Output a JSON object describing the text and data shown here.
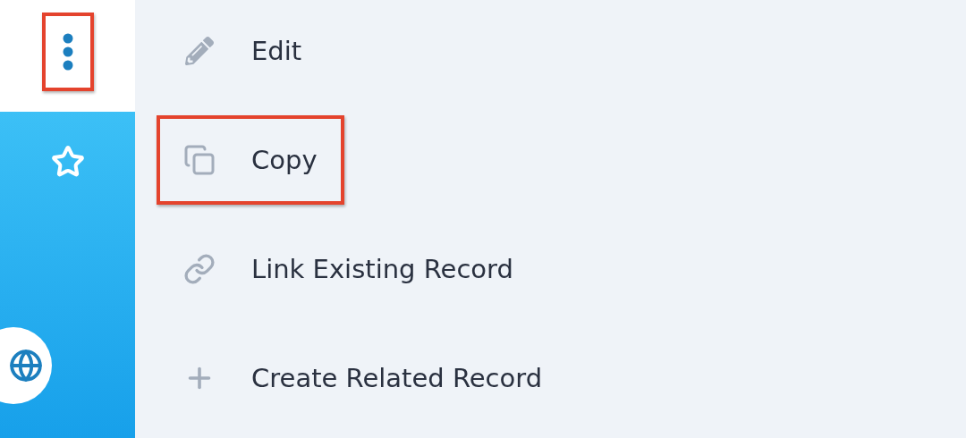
{
  "sidebar": {
    "more_button": {
      "highlighted": true
    }
  },
  "menu": {
    "items": [
      {
        "kind": "edit",
        "label": "Edit",
        "highlighted": false
      },
      {
        "kind": "copy",
        "label": "Copy",
        "highlighted": true
      },
      {
        "kind": "link",
        "label": "Link Existing Record",
        "highlighted": false
      },
      {
        "kind": "create",
        "label": "Create Related Record",
        "highlighted": false
      }
    ]
  }
}
